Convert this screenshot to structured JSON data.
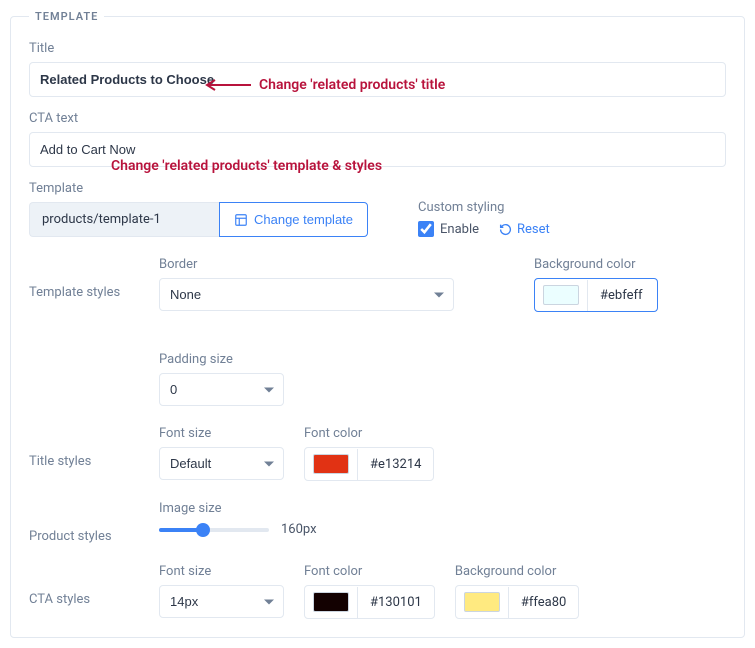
{
  "legend": "TEMPLATE",
  "title": {
    "label": "Title",
    "value": "Related Products to Choose"
  },
  "cta_text": {
    "label": "CTA text",
    "value": "Add to Cart Now"
  },
  "template": {
    "label": "Template",
    "value": "products/template-1",
    "change_btn": "Change template"
  },
  "custom_styling": {
    "label": "Custom styling",
    "enable_label": "Enable",
    "reset_label": "Reset"
  },
  "template_styles": {
    "label": "Template styles",
    "border": {
      "label": "Border",
      "value": "None"
    },
    "bg": {
      "label": "Background color",
      "hex": "#ebfeff"
    },
    "padding": {
      "label": "Padding size",
      "value": "0"
    }
  },
  "title_styles": {
    "label": "Title styles",
    "font_size": {
      "label": "Font size",
      "value": "Default"
    },
    "font_color": {
      "label": "Font color",
      "hex": "#e13214"
    }
  },
  "product_styles": {
    "label": "Product styles",
    "image_size": {
      "label": "Image size",
      "value": "160px"
    }
  },
  "cta_styles": {
    "label": "CTA styles",
    "font_size": {
      "label": "Font size",
      "value": "14px"
    },
    "font_color": {
      "label": "Font color",
      "hex": "#130101"
    },
    "bg": {
      "label": "Background color",
      "hex": "#ffea80"
    }
  },
  "annotations": {
    "a1": "Change 'related products' title",
    "a2": "Change 'related products' template & styles"
  }
}
